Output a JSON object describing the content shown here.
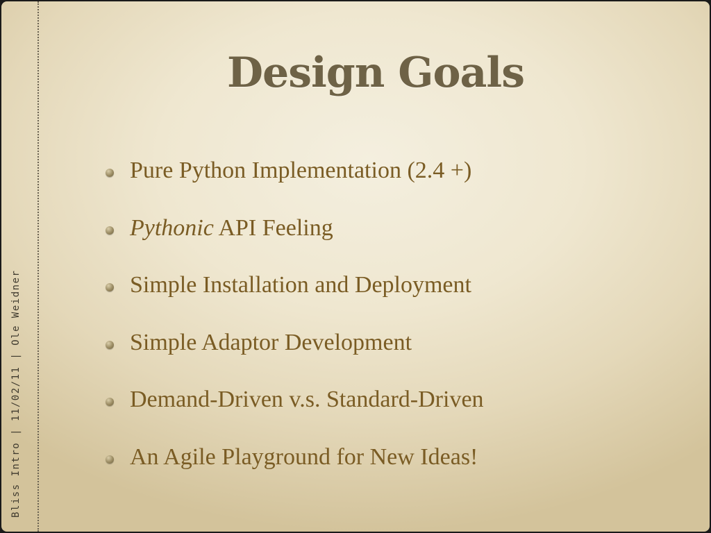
{
  "slide": {
    "side_text": "Bliss Intro | 11/02/11 | Ole Weidner",
    "title": "Design Goals",
    "bullets": [
      {
        "text": "Pure Python Implementation (2.4 +)"
      },
      {
        "emphasis": "Pythonic",
        "rest": " API Feeling"
      },
      {
        "text": "Simple Installation and Deployment"
      },
      {
        "text": "Simple Adaptor Development"
      },
      {
        "text": "Demand-Driven v.s. Standard-Driven"
      },
      {
        "text": "An Agile Playground for New Ideas!"
      }
    ]
  }
}
